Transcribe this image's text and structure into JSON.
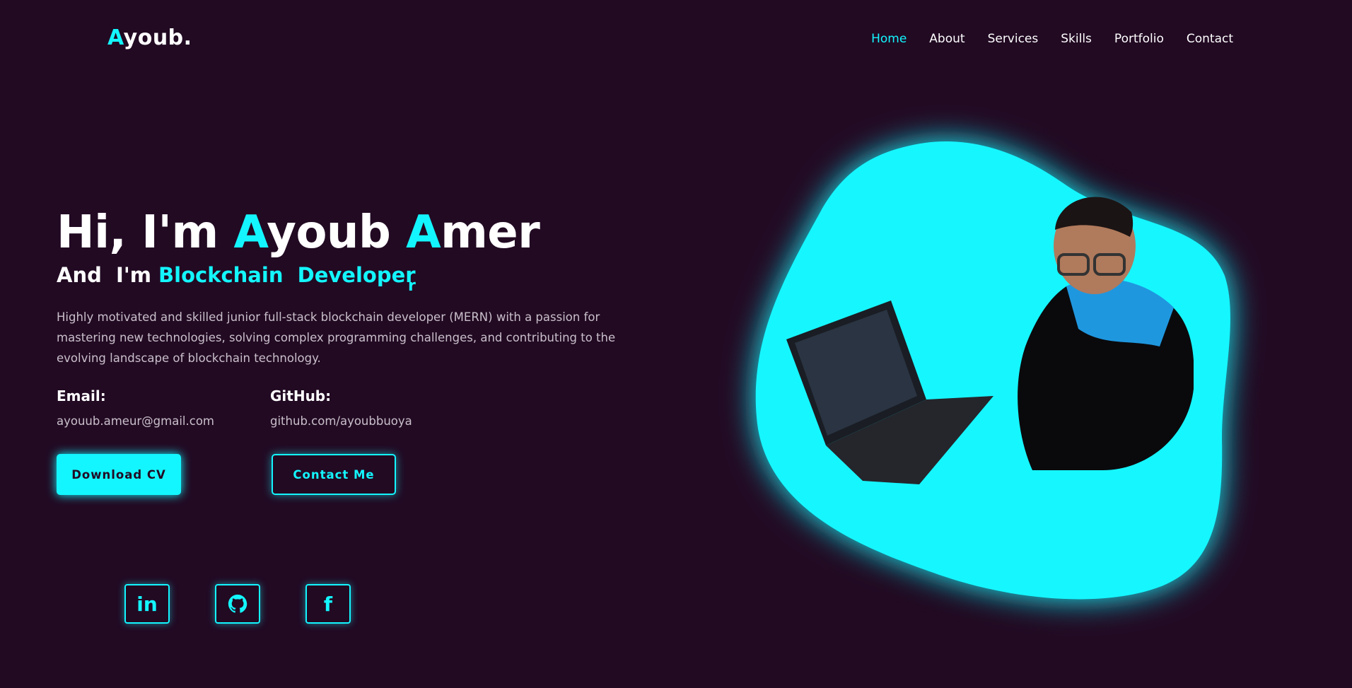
{
  "header": {
    "logo": {
      "accent": "A",
      "rest": "youb."
    },
    "nav": [
      {
        "label": "Home",
        "active": true
      },
      {
        "label": "About",
        "active": false
      },
      {
        "label": "Services",
        "active": false
      },
      {
        "label": "Skills",
        "active": false
      },
      {
        "label": "Portfolio",
        "active": false
      },
      {
        "label": "Contact",
        "active": false
      }
    ]
  },
  "hero": {
    "greeting": "Hi, I'm ",
    "first_accent": "A",
    "first_rest": "youb ",
    "last_accent": "A",
    "last_rest": "mer",
    "subtitle_prefix": "And  I'm ",
    "subtitle_role": "Blockchain  Developer",
    "typing_char": "r",
    "description": "Highly motivated and skilled junior full-stack blockchain developer (MERN) with a passion for mastering new technologies, solving complex programming challenges, and contributing to the evolving landscape of blockchain technology."
  },
  "contacts": {
    "email_label": "Email:",
    "email_value": "ayouub.ameur@gmail.com",
    "github_label": "GitHub:",
    "github_value": "github.com/ayoubbuoya"
  },
  "buttons": {
    "download": "Download CV",
    "contact": "Contact Me"
  },
  "socials": {
    "linkedin_text": "in",
    "facebook_text": "f"
  },
  "icons": {
    "linkedin": "linkedin-icon",
    "github": "github-icon",
    "facebook": "facebook-icon"
  },
  "colors": {
    "background": "#220a23",
    "accent": "#13f6ff",
    "text": "#ffffff",
    "muted": "#c9bfca"
  }
}
